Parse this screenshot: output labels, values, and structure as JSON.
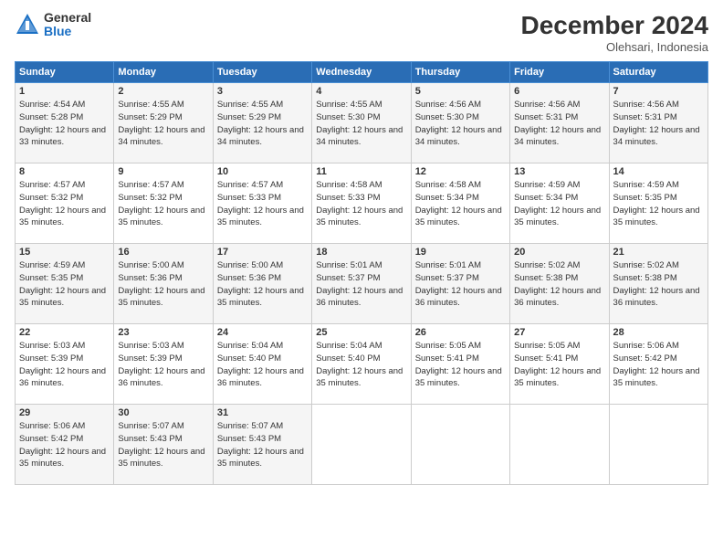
{
  "header": {
    "logo_general": "General",
    "logo_blue": "Blue",
    "month_title": "December 2024",
    "subtitle": "Olehsari, Indonesia"
  },
  "days_of_week": [
    "Sunday",
    "Monday",
    "Tuesday",
    "Wednesday",
    "Thursday",
    "Friday",
    "Saturday"
  ],
  "weeks": [
    [
      {
        "day": "1",
        "sunrise": "4:54 AM",
        "sunset": "5:28 PM",
        "daylight": "12 hours and 33 minutes."
      },
      {
        "day": "2",
        "sunrise": "4:55 AM",
        "sunset": "5:29 PM",
        "daylight": "12 hours and 34 minutes."
      },
      {
        "day": "3",
        "sunrise": "4:55 AM",
        "sunset": "5:29 PM",
        "daylight": "12 hours and 34 minutes."
      },
      {
        "day": "4",
        "sunrise": "4:55 AM",
        "sunset": "5:30 PM",
        "daylight": "12 hours and 34 minutes."
      },
      {
        "day": "5",
        "sunrise": "4:56 AM",
        "sunset": "5:30 PM",
        "daylight": "12 hours and 34 minutes."
      },
      {
        "day": "6",
        "sunrise": "4:56 AM",
        "sunset": "5:31 PM",
        "daylight": "12 hours and 34 minutes."
      },
      {
        "day": "7",
        "sunrise": "4:56 AM",
        "sunset": "5:31 PM",
        "daylight": "12 hours and 34 minutes."
      }
    ],
    [
      {
        "day": "8",
        "sunrise": "4:57 AM",
        "sunset": "5:32 PM",
        "daylight": "12 hours and 35 minutes."
      },
      {
        "day": "9",
        "sunrise": "4:57 AM",
        "sunset": "5:32 PM",
        "daylight": "12 hours and 35 minutes."
      },
      {
        "day": "10",
        "sunrise": "4:57 AM",
        "sunset": "5:33 PM",
        "daylight": "12 hours and 35 minutes."
      },
      {
        "day": "11",
        "sunrise": "4:58 AM",
        "sunset": "5:33 PM",
        "daylight": "12 hours and 35 minutes."
      },
      {
        "day": "12",
        "sunrise": "4:58 AM",
        "sunset": "5:34 PM",
        "daylight": "12 hours and 35 minutes."
      },
      {
        "day": "13",
        "sunrise": "4:59 AM",
        "sunset": "5:34 PM",
        "daylight": "12 hours and 35 minutes."
      },
      {
        "day": "14",
        "sunrise": "4:59 AM",
        "sunset": "5:35 PM",
        "daylight": "12 hours and 35 minutes."
      }
    ],
    [
      {
        "day": "15",
        "sunrise": "4:59 AM",
        "sunset": "5:35 PM",
        "daylight": "12 hours and 35 minutes."
      },
      {
        "day": "16",
        "sunrise": "5:00 AM",
        "sunset": "5:36 PM",
        "daylight": "12 hours and 35 minutes."
      },
      {
        "day": "17",
        "sunrise": "5:00 AM",
        "sunset": "5:36 PM",
        "daylight": "12 hours and 35 minutes."
      },
      {
        "day": "18",
        "sunrise": "5:01 AM",
        "sunset": "5:37 PM",
        "daylight": "12 hours and 36 minutes."
      },
      {
        "day": "19",
        "sunrise": "5:01 AM",
        "sunset": "5:37 PM",
        "daylight": "12 hours and 36 minutes."
      },
      {
        "day": "20",
        "sunrise": "5:02 AM",
        "sunset": "5:38 PM",
        "daylight": "12 hours and 36 minutes."
      },
      {
        "day": "21",
        "sunrise": "5:02 AM",
        "sunset": "5:38 PM",
        "daylight": "12 hours and 36 minutes."
      }
    ],
    [
      {
        "day": "22",
        "sunrise": "5:03 AM",
        "sunset": "5:39 PM",
        "daylight": "12 hours and 36 minutes."
      },
      {
        "day": "23",
        "sunrise": "5:03 AM",
        "sunset": "5:39 PM",
        "daylight": "12 hours and 36 minutes."
      },
      {
        "day": "24",
        "sunrise": "5:04 AM",
        "sunset": "5:40 PM",
        "daylight": "12 hours and 36 minutes."
      },
      {
        "day": "25",
        "sunrise": "5:04 AM",
        "sunset": "5:40 PM",
        "daylight": "12 hours and 35 minutes."
      },
      {
        "day": "26",
        "sunrise": "5:05 AM",
        "sunset": "5:41 PM",
        "daylight": "12 hours and 35 minutes."
      },
      {
        "day": "27",
        "sunrise": "5:05 AM",
        "sunset": "5:41 PM",
        "daylight": "12 hours and 35 minutes."
      },
      {
        "day": "28",
        "sunrise": "5:06 AM",
        "sunset": "5:42 PM",
        "daylight": "12 hours and 35 minutes."
      }
    ],
    [
      {
        "day": "29",
        "sunrise": "5:06 AM",
        "sunset": "5:42 PM",
        "daylight": "12 hours and 35 minutes."
      },
      {
        "day": "30",
        "sunrise": "5:07 AM",
        "sunset": "5:43 PM",
        "daylight": "12 hours and 35 minutes."
      },
      {
        "day": "31",
        "sunrise": "5:07 AM",
        "sunset": "5:43 PM",
        "daylight": "12 hours and 35 minutes."
      },
      null,
      null,
      null,
      null
    ]
  ]
}
